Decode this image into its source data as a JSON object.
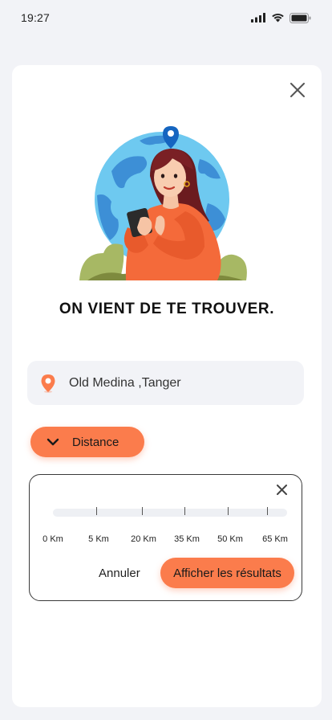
{
  "status_bar": {
    "time": "19:27"
  },
  "headline": "ON VIENT DE TE TROUVER.",
  "location": {
    "value": "Old Medina ,Tanger"
  },
  "distance_button": {
    "label": "Distance"
  },
  "distance_filter": {
    "ticks": [
      "0 Km",
      "5 Km",
      "20 Km",
      "35 Km",
      "50 Km",
      "65 Km"
    ],
    "cancel_label": "Annuler",
    "submit_label": "Afficher les résultats"
  },
  "colors": {
    "accent": "#fb7c4c",
    "pin_blue": "#1565c0",
    "globe": "#6ec9f0"
  },
  "icons": {
    "close": "close-icon",
    "pin": "location-pin-icon",
    "chevron": "chevron-down-icon"
  }
}
